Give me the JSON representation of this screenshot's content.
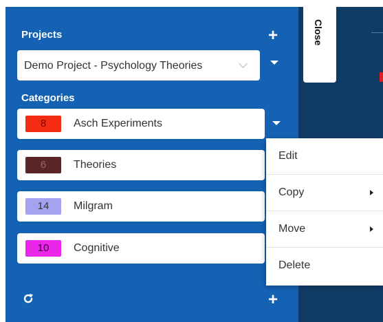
{
  "close_tab": {
    "label": "Close"
  },
  "projects": {
    "heading": "Projects",
    "add_label": "+",
    "selected": "Demo Project - Psychology Theories"
  },
  "categories": {
    "heading": "Categories",
    "items": [
      {
        "count": "8",
        "label": "Asch Experiments",
        "color": "#f52c14",
        "text_color": "#7a0a00"
      },
      {
        "count": "6",
        "label": "Theories",
        "color": "#5a2527",
        "text_color": "#8a6a6a"
      },
      {
        "count": "14",
        "label": "Milgram",
        "color": "#a3a3f0",
        "text_color": "#333333"
      },
      {
        "count": "10",
        "label": "Cognitive",
        "color": "#ea26ea",
        "text_color": "#3a003a"
      }
    ]
  },
  "footer": {
    "add_label": "+"
  },
  "context_menu": {
    "items": [
      {
        "label": "Edit"
      },
      {
        "label": "Copy"
      },
      {
        "label": "Move"
      },
      {
        "label": "Delete"
      }
    ]
  }
}
